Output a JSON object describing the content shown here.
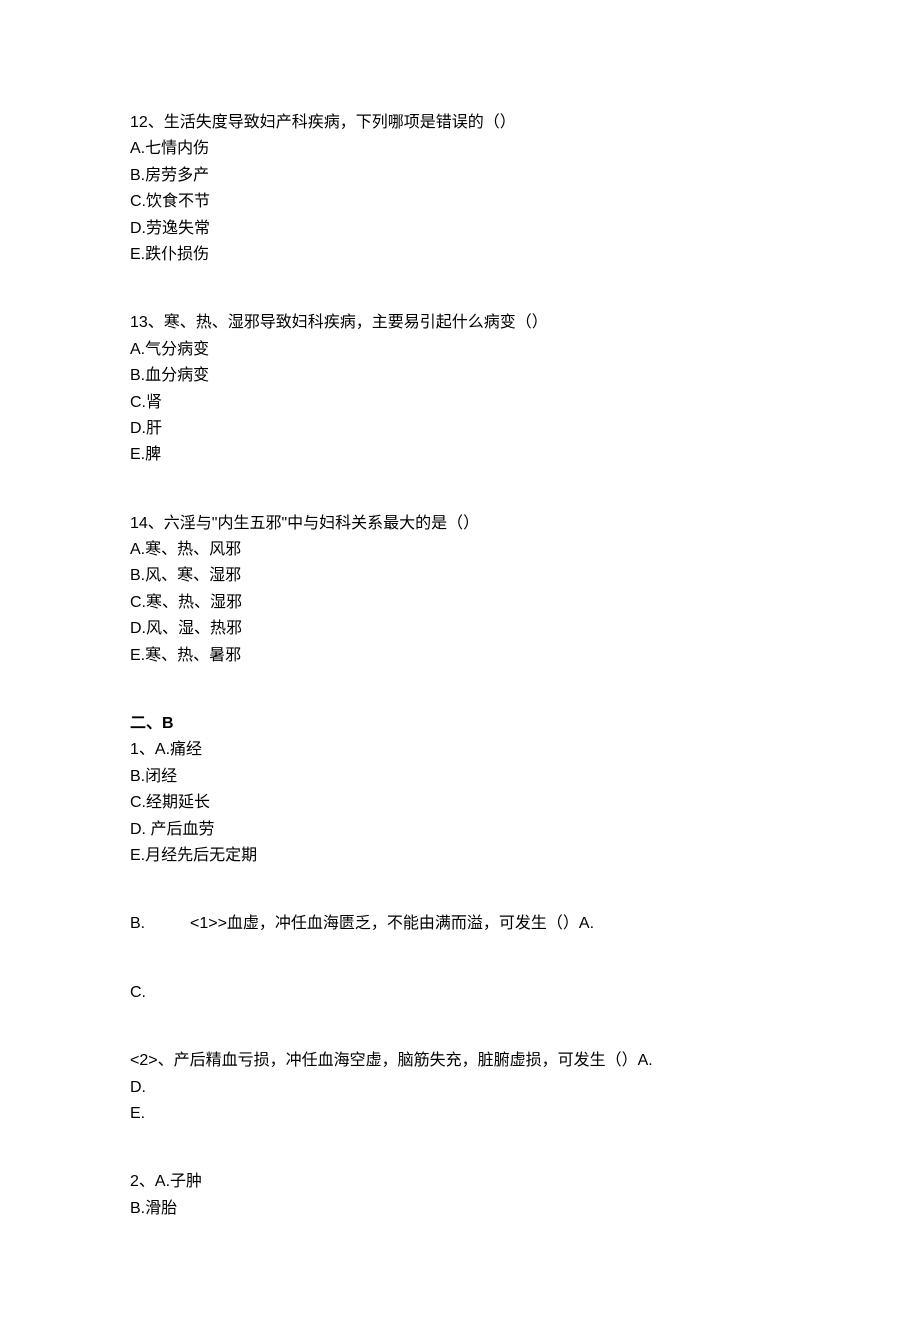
{
  "q12": {
    "stem": "12、生活失度导致妇产科疾病，下列哪项是错误的（）",
    "a": "A.七情内伤",
    "b": "B.房劳多产",
    "c": "C.饮食不节",
    "d": "D.劳逸失常",
    "e": "E.跌仆损伤"
  },
  "q13": {
    "stem": "13、寒、热、湿邪导致妇科疾病，主要易引起什么病变（）",
    "a": "A.气分病变",
    "b": "B.血分病变",
    "c": "C.肾",
    "d": "D.肝",
    "e": "E.脾"
  },
  "q14": {
    "stem": "14、六淫与\"内生五邪\"中与妇科关系最大的是（）",
    "a": "A.寒、热、风邪",
    "b": "B.风、寒、湿邪",
    "c": "C.寒、热、湿邪",
    "d": "D.风、湿、热邪",
    "e": "E.寒、热、暑邪"
  },
  "sectionB": {
    "header": "二、B",
    "q1": {
      "a": "1、A.痛经",
      "b": "B.闭经",
      "c": "C.经期延长",
      "d": "D. 产后血劳",
      "e": "E.月经先后无定期",
      "line_b_label": "B.",
      "line_b_text": "<1>>血虚，冲任血海匮乏，不能由满而溢，可发生（）A.",
      "line_c_label": "C.",
      "sub2": "<2>、产后精血亏损，冲任血海空虚，脑筋失充，脏腑虚损，可发生（）A.",
      "line_d": "D.",
      "line_e": "E."
    },
    "q2": {
      "a": "2、A.子肿",
      "b": "B.滑胎"
    }
  }
}
